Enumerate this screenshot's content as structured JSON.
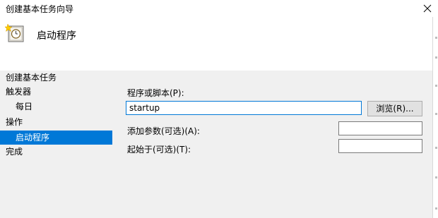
{
  "window": {
    "title": "创建基本任务向导"
  },
  "header": {
    "title": "启动程序",
    "icon": "task-clock-icon"
  },
  "sidebar": {
    "items": [
      {
        "label": "创建基本任务",
        "level": 0,
        "selected": false
      },
      {
        "label": "触发器",
        "level": 0,
        "selected": false
      },
      {
        "label": "每日",
        "level": 1,
        "selected": false
      },
      {
        "label": "操作",
        "level": 0,
        "selected": false
      },
      {
        "label": "启动程序",
        "level": 1,
        "selected": true
      },
      {
        "label": "完成",
        "level": 0,
        "selected": false
      }
    ]
  },
  "main": {
    "program_label": "程序或脚本(P):",
    "program_value": "startup",
    "browse_label": "浏览(R)...",
    "args_label": "添加参数(可选)(A):",
    "args_value": "",
    "startin_label": "起始于(可选)(T):",
    "startin_value": ""
  },
  "colors": {
    "selection": "#0078d7",
    "background": "#f0f0f0"
  }
}
